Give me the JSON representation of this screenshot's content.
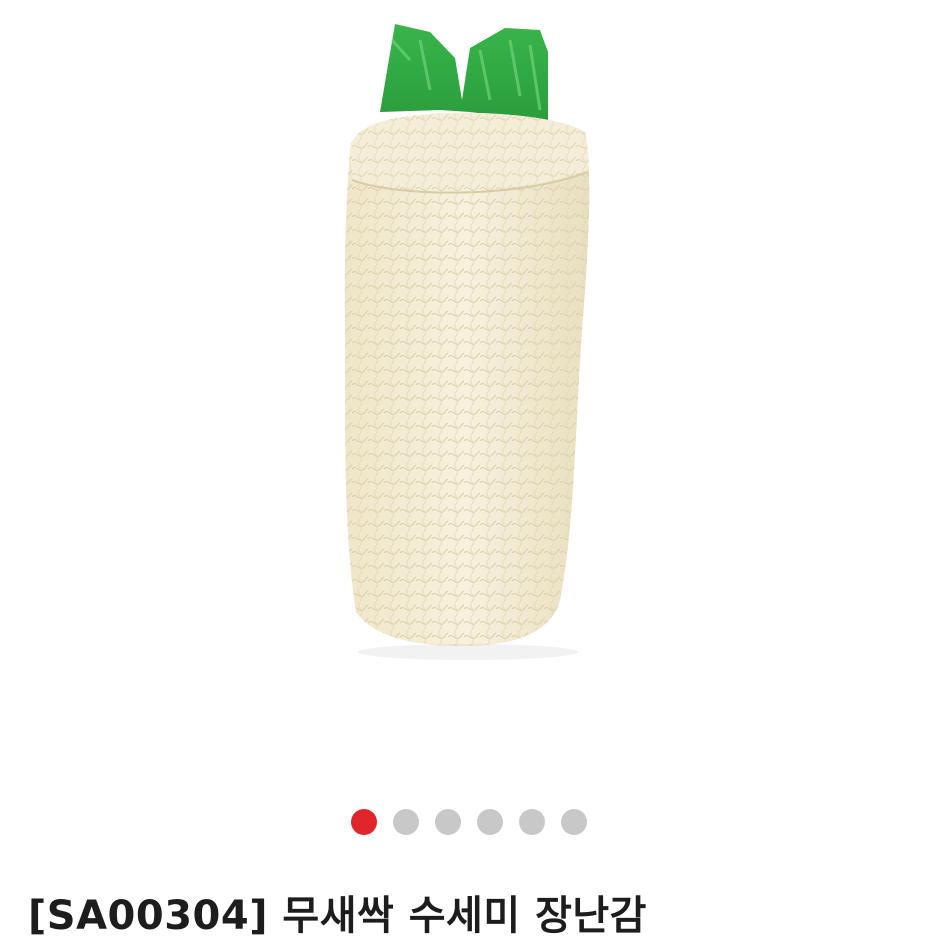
{
  "product": {
    "title": "[SA00304] 무새싹 수세미 장난감",
    "image_icon": "loofah-radish-toy-image"
  },
  "carousel": {
    "total": 6,
    "active_index": 0,
    "active_color": "#e0262b",
    "inactive_color": "#c8c8c8"
  }
}
